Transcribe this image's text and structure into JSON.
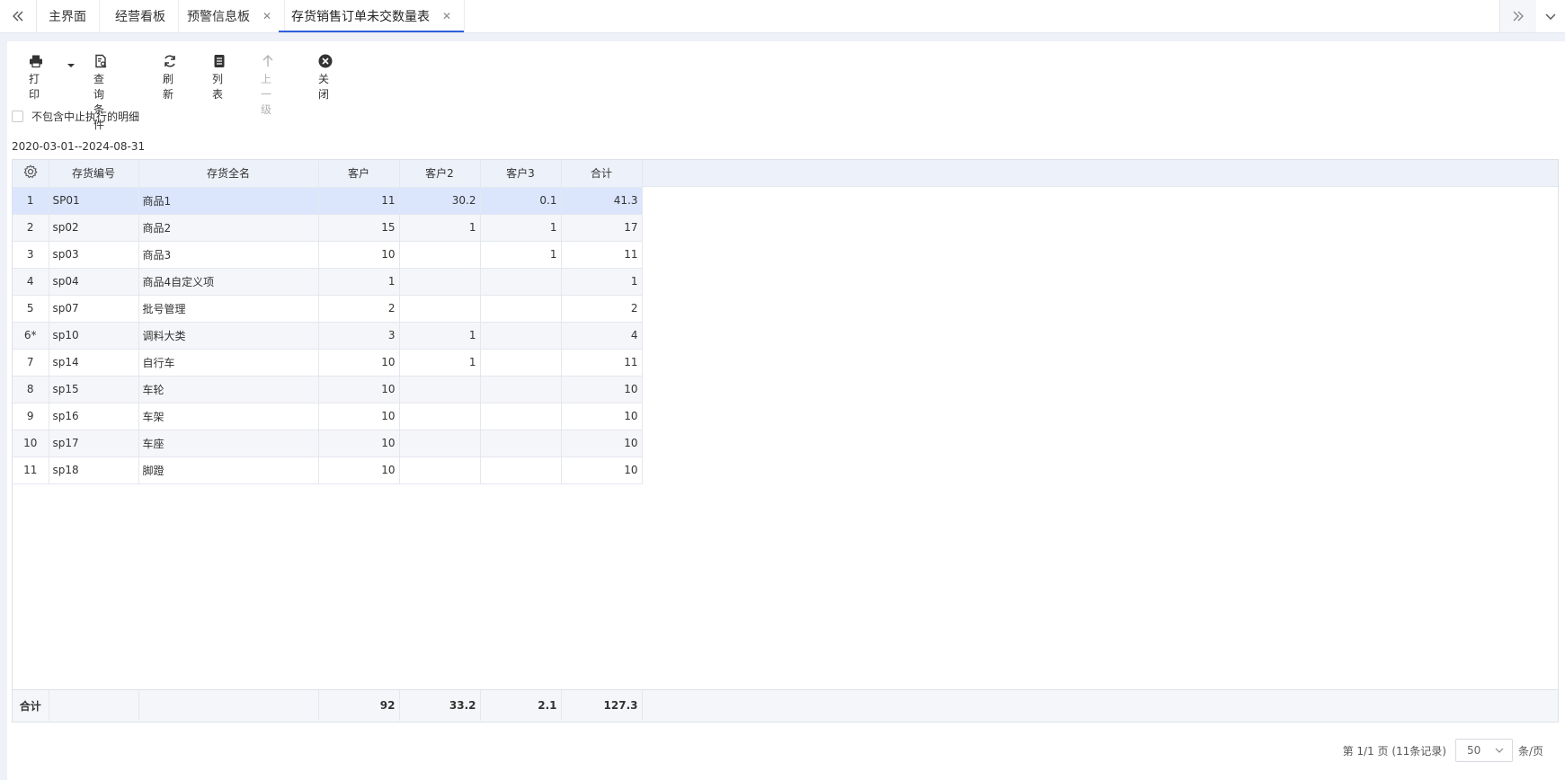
{
  "tabs": [
    {
      "label": "主界面",
      "closable": false,
      "active": false
    },
    {
      "label": "经营看板",
      "closable": false,
      "active": false
    },
    {
      "label": "预警信息板",
      "closable": true,
      "active": false
    },
    {
      "label": "存货销售订单未交数量表",
      "closable": true,
      "active": true
    }
  ],
  "toolbar": {
    "print": "打印",
    "query": "查询条件",
    "refresh": "刷新",
    "list": "列表",
    "up": "上一级",
    "close": "关闭"
  },
  "filter": {
    "exclude_terminated_label": "不包含中止执行的明细",
    "checked": false
  },
  "date_range": "2020-03-01--2024-08-31",
  "table": {
    "columns": [
      "存货编号",
      "存货全名",
      "客户",
      "客户2",
      "客户3",
      "合计"
    ],
    "rows": [
      {
        "idx": "1",
        "code": "SP01",
        "name": "商品1",
        "c1": "11",
        "c2": "30.2",
        "c3": "0.1",
        "total": "41.3"
      },
      {
        "idx": "2",
        "code": "sp02",
        "name": "商品2",
        "c1": "15",
        "c2": "1",
        "c3": "1",
        "total": "17"
      },
      {
        "idx": "3",
        "code": "sp03",
        "name": "商品3",
        "c1": "10",
        "c2": "",
        "c3": "1",
        "total": "11"
      },
      {
        "idx": "4",
        "code": "sp04",
        "name": "商品4自定义项",
        "c1": "1",
        "c2": "",
        "c3": "",
        "total": "1"
      },
      {
        "idx": "5",
        "code": "sp07",
        "name": "批号管理",
        "c1": "2",
        "c2": "",
        "c3": "",
        "total": "2"
      },
      {
        "idx": "6*",
        "code": "sp10",
        "name": "调料大类",
        "c1": "3",
        "c2": "1",
        "c3": "",
        "total": "4"
      },
      {
        "idx": "7",
        "code": "sp14",
        "name": "自行车",
        "c1": "10",
        "c2": "1",
        "c3": "",
        "total": "11"
      },
      {
        "idx": "8",
        "code": "sp15",
        "name": "车轮",
        "c1": "10",
        "c2": "",
        "c3": "",
        "total": "10"
      },
      {
        "idx": "9",
        "code": "sp16",
        "name": "车架",
        "c1": "10",
        "c2": "",
        "c3": "",
        "total": "10"
      },
      {
        "idx": "10",
        "code": "sp17",
        "name": "车座",
        "c1": "10",
        "c2": "",
        "c3": "",
        "total": "10"
      },
      {
        "idx": "11",
        "code": "sp18",
        "name": "脚蹬",
        "c1": "10",
        "c2": "",
        "c3": "",
        "total": "10"
      }
    ],
    "footer": {
      "label": "合计",
      "c1": "92",
      "c2": "33.2",
      "c3": "2.1",
      "total": "127.3"
    }
  },
  "pager": {
    "summary": "第 1/1 页 (11条记录)",
    "page_size": "50",
    "unit": "条/页"
  },
  "colors": {
    "accent": "#2f5fdc",
    "selected_row": "#dbe6fd",
    "header_bg": "#edf1f9"
  }
}
